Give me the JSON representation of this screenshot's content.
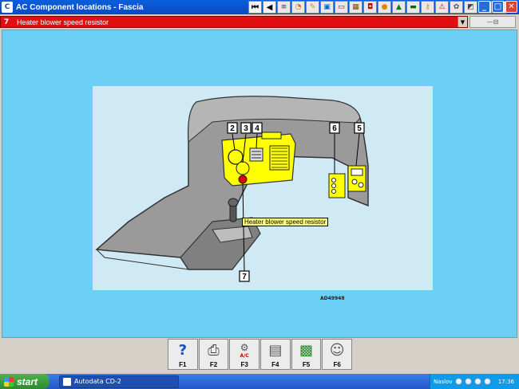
{
  "window": {
    "title": "AC Component locations - Fascia",
    "app_icon": "C"
  },
  "toolbar_icons": [
    "first-page-icon",
    "prev-page-icon",
    "text-icon",
    "gauge-icon",
    "wrench-icon",
    "engine-icon",
    "battery-icon",
    "chip-icon",
    "relay-icon",
    "bulb-icon",
    "car-icon",
    "tools-icon",
    "key-icon",
    "warning-icon",
    "fan-icon",
    "box-icon",
    "settings-icon",
    "pen-icon"
  ],
  "selection": {
    "number": "7",
    "label": "Heater blower speed resistor"
  },
  "diagram": {
    "callout_labels": [
      "2",
      "3",
      "4",
      "6",
      "5",
      "7"
    ],
    "tooltip": "Heater blower speed resistor",
    "drawing_code": "AD49948"
  },
  "fkeys": [
    {
      "label": "F1",
      "icon": "help-icon"
    },
    {
      "label": "F2",
      "icon": "print-icon"
    },
    {
      "label": "F3",
      "icon": "ac-icon"
    },
    {
      "label": "F4",
      "icon": "document-icon"
    },
    {
      "label": "F5",
      "icon": "circuit-icon"
    },
    {
      "label": "F6",
      "icon": "people-icon"
    }
  ],
  "fkey_f3_tag": "A/C",
  "taskbar": {
    "start_label": "start",
    "task_label": "Autodata CD-2",
    "tray_text": "Naslov",
    "clock": "17:36"
  },
  "colors": {
    "selection_bg": "#e01010",
    "content_bg": "#6ccff6",
    "highlight_yellow": "#ffff00",
    "pointer_red": "#e00000"
  }
}
